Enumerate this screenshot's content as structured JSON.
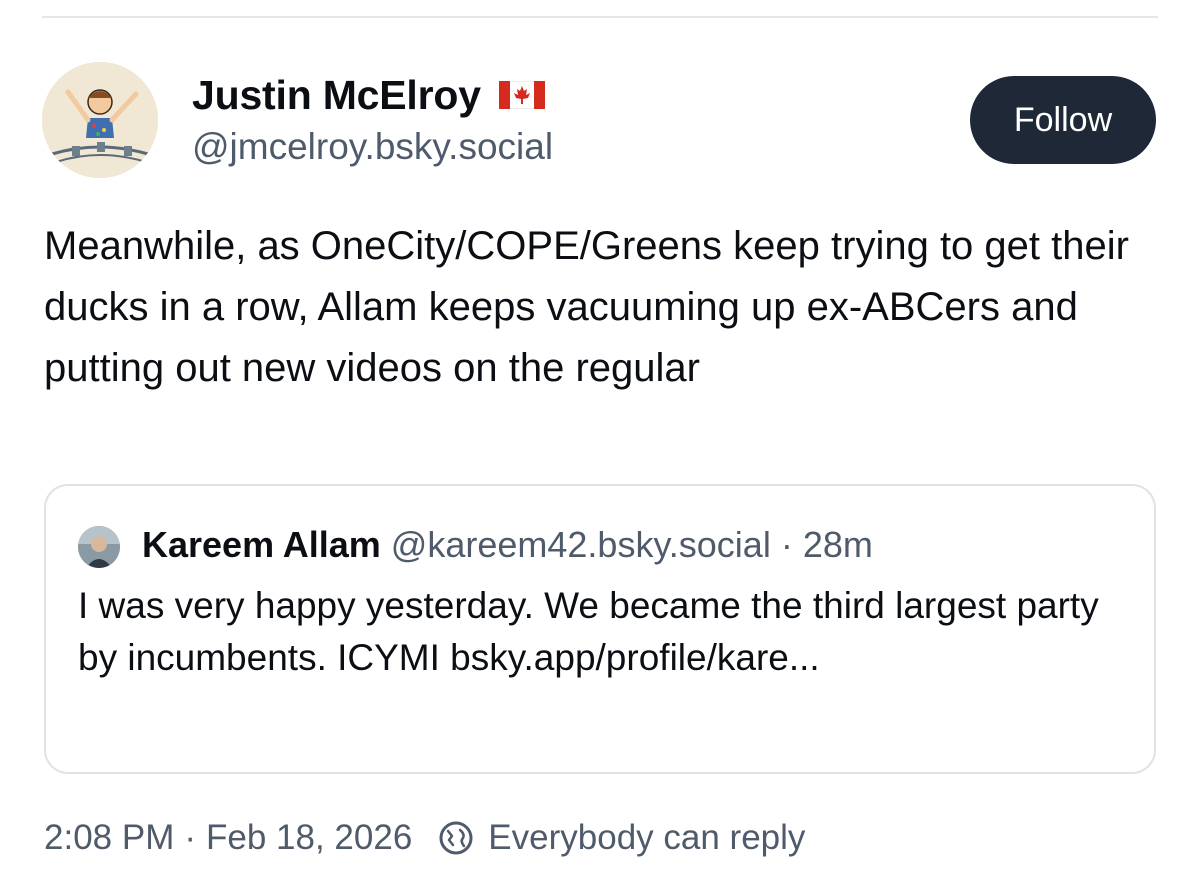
{
  "author": {
    "display_name": "Justin McElroy",
    "flag_icon": "canada-flag-icon",
    "handle": "@jmcelroy.bsky.social"
  },
  "follow_label": "Follow",
  "post": {
    "text": "Meanwhile, as OneCity/COPE/Greens keep trying to get their ducks in a row, Allam keeps vacuuming up ex-ABCers and putting out new videos on the regular"
  },
  "quote": {
    "name": "Kareem Allam",
    "handle": "@kareem42.bsky.social",
    "separator": "·",
    "age": "28m",
    "text": "I was very happy yesterday. We became the third largest party by incumbents. ICYMI bsky.app/profile/kare..."
  },
  "meta": {
    "time": "2:08 PM",
    "separator": "·",
    "date": "Feb 18, 2026",
    "reply_icon": "reply-settings-icon",
    "reply_setting": "Everybody can reply"
  },
  "colors": {
    "follow_bg": "#1f2837",
    "text_primary": "#0b0f14",
    "text_secondary": "#4f5b6a",
    "border": "#dfe2e8"
  }
}
